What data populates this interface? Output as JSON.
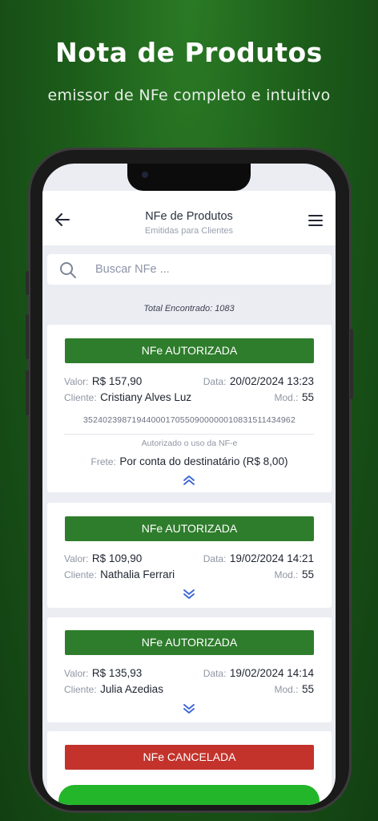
{
  "promo": {
    "title": "Nota de Produtos",
    "subtitle": "emissor de NFe completo e intuitivo"
  },
  "header": {
    "title": "NFe de Produtos",
    "subtitle": "Emitidas para Clientes",
    "back_icon": "arrow-left-icon",
    "menu_icon": "hamburger-menu-icon"
  },
  "search": {
    "placeholder": "Buscar NFe ...",
    "value": ""
  },
  "total": "Total Encontrado: 1083",
  "labels": {
    "valor": "Valor:",
    "data": "Data:",
    "cliente": "Cliente:",
    "mod": "Mod.:",
    "frete": "Frete:"
  },
  "cards": [
    {
      "status": "NFe AUTORIZADA",
      "valor": "R$ 157,90",
      "data": "20/02/2024 13:23",
      "cliente": "Cristiany Alves Luz",
      "mod": "55",
      "chave": "35240239871944000170550900000010831511434962",
      "autorizacao": "Autorizado o uso da NF-e",
      "frete": "Por conta do destinatário (R$ 8,00)",
      "expanded": true
    },
    {
      "status": "NFe AUTORIZADA",
      "valor": "R$ 109,90",
      "data": "19/02/2024 14:21",
      "cliente": "Nathalia Ferrari",
      "mod": "55",
      "expanded": false
    },
    {
      "status": "NFe AUTORIZADA",
      "valor": "R$ 135,93",
      "data": "19/02/2024 14:14",
      "cliente": "Julia Azedias",
      "mod": "55",
      "expanded": false
    },
    {
      "status": "NFe CANCELADA",
      "expanded": false
    }
  ],
  "colors": {
    "authorized": "#2e7d2c",
    "cancelled": "#c3332c",
    "accent": "#3b63d8",
    "fab": "#23b52a"
  }
}
